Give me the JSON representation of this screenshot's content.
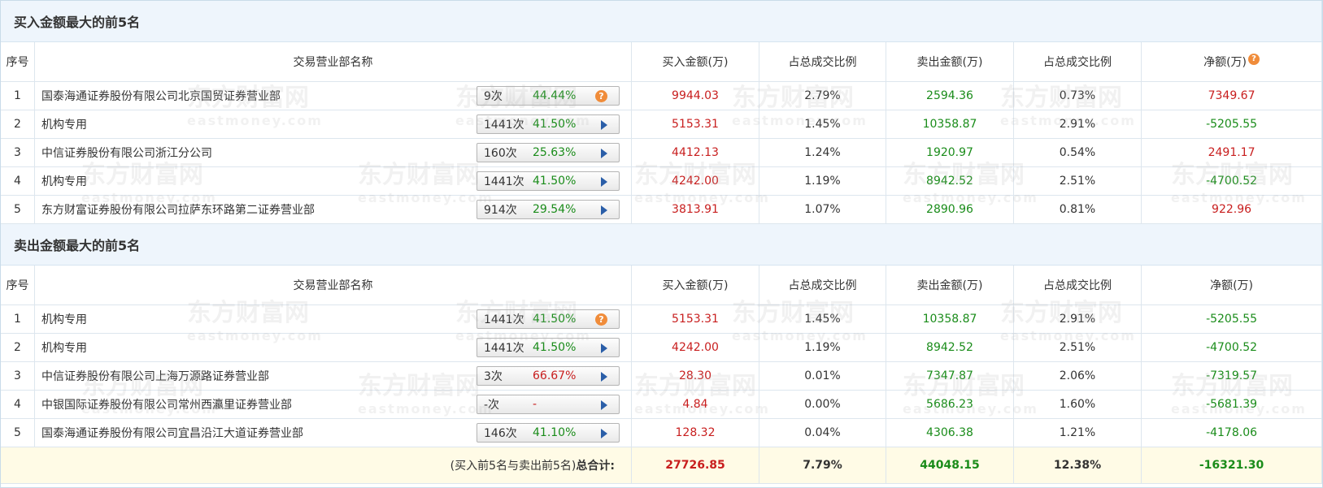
{
  "buy_section": {
    "title": "买入金额最大的前5名",
    "headers": [
      "序号",
      "交易营业部名称",
      "买入金额(万)",
      "占总成交比例",
      "卖出金额(万)",
      "占总成交比例",
      "净额(万)"
    ],
    "rows": [
      {
        "idx": "1",
        "name": "国泰海通证券股份有限公司北京国贸证券营业部",
        "count": "9次",
        "pct": "44.44%",
        "icon": "question-icon",
        "buy": "9944.03",
        "buy_ratio": "2.79%",
        "sell": "2594.36",
        "sell_ratio": "0.73%",
        "net": "7349.67",
        "net_color": "red"
      },
      {
        "idx": "2",
        "name": "机构专用",
        "count": "1441次",
        "pct": "41.50%",
        "icon": "arrow-right-icon",
        "buy": "5153.31",
        "buy_ratio": "1.45%",
        "sell": "10358.87",
        "sell_ratio": "2.91%",
        "net": "-5205.55",
        "net_color": "green"
      },
      {
        "idx": "3",
        "name": "中信证券股份有限公司浙江分公司",
        "count": "160次",
        "pct": "25.63%",
        "icon": "arrow-right-icon",
        "buy": "4412.13",
        "buy_ratio": "1.24%",
        "sell": "1920.97",
        "sell_ratio": "0.54%",
        "net": "2491.17",
        "net_color": "red"
      },
      {
        "idx": "4",
        "name": "机构专用",
        "count": "1441次",
        "pct": "41.50%",
        "icon": "arrow-right-icon",
        "buy": "4242.00",
        "buy_ratio": "1.19%",
        "sell": "8942.52",
        "sell_ratio": "2.51%",
        "net": "-4700.52",
        "net_color": "green"
      },
      {
        "idx": "5",
        "name": "东方财富证券股份有限公司拉萨东环路第二证券营业部",
        "count": "914次",
        "pct": "29.54%",
        "icon": "arrow-right-icon",
        "buy": "3813.91",
        "buy_ratio": "1.07%",
        "sell": "2890.96",
        "sell_ratio": "0.81%",
        "net": "922.96",
        "net_color": "red"
      }
    ]
  },
  "sell_section": {
    "title": "卖出金额最大的前5名",
    "headers": [
      "序号",
      "交易营业部名称",
      "买入金额(万)",
      "占总成交比例",
      "卖出金额(万)",
      "占总成交比例",
      "净额(万)"
    ],
    "rows": [
      {
        "idx": "1",
        "name": "机构专用",
        "count": "1441次",
        "pct": "41.50%",
        "icon": "question-icon",
        "buy": "5153.31",
        "buy_ratio": "1.45%",
        "sell": "10358.87",
        "sell_ratio": "2.91%",
        "net": "-5205.55",
        "net_color": "green"
      },
      {
        "idx": "2",
        "name": "机构专用",
        "count": "1441次",
        "pct": "41.50%",
        "icon": "arrow-right-icon",
        "buy": "4242.00",
        "buy_ratio": "1.19%",
        "sell": "8942.52",
        "sell_ratio": "2.51%",
        "net": "-4700.52",
        "net_color": "green"
      },
      {
        "idx": "3",
        "name": "中信证券股份有限公司上海万源路证券营业部",
        "count": "3次",
        "pct": "66.67%",
        "icon": "arrow-right-icon",
        "buy": "28.30",
        "buy_ratio": "0.01%",
        "sell": "7347.87",
        "sell_ratio": "2.06%",
        "net": "-7319.57",
        "net_color": "green"
      },
      {
        "idx": "4",
        "name": "中银国际证券股份有限公司常州西瀛里证券营业部",
        "count": "-次",
        "pct": "-",
        "icon": "arrow-right-icon",
        "buy": "4.84",
        "buy_ratio": "0.00%",
        "sell": "5686.23",
        "sell_ratio": "1.60%",
        "net": "-5681.39",
        "net_color": "green"
      },
      {
        "idx": "5",
        "name": "国泰海通证券股份有限公司宜昌沿江大道证券营业部",
        "count": "146次",
        "pct": "41.10%",
        "icon": "arrow-right-icon",
        "buy": "128.32",
        "buy_ratio": "0.04%",
        "sell": "4306.38",
        "sell_ratio": "1.21%",
        "net": "-4178.06",
        "net_color": "green"
      }
    ]
  },
  "total": {
    "label_prefix": "(买入前5名与卖出前5名)",
    "label_bold": "总合计:",
    "buy": "27726.85",
    "buy_ratio": "7.79%",
    "sell": "44048.15",
    "sell_ratio": "12.38%",
    "net": "-16321.30"
  },
  "watermark": {
    "brand": "东方财富网",
    "url": "eastmoney.com"
  },
  "colors": {
    "red": "#c81e1e",
    "green": "#1a8c1a",
    "header_bg": "#eef5fc",
    "total_bg": "#fffbe6",
    "icon_orange": "#f08c3a",
    "arrow_blue": "#2a5ea8"
  }
}
